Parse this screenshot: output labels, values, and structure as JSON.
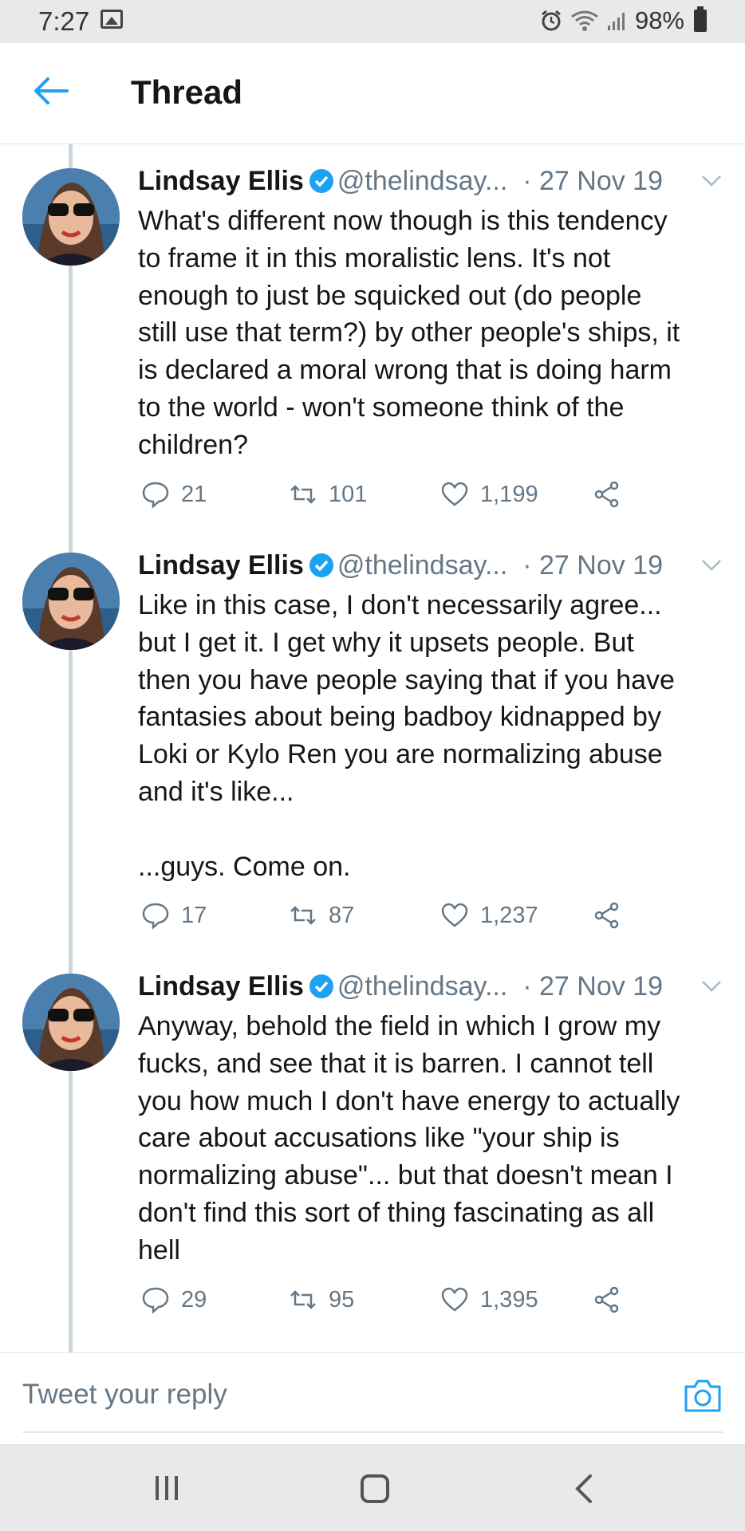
{
  "status_bar": {
    "time": "7:27",
    "battery": "98%"
  },
  "header": {
    "title": "Thread"
  },
  "tweets": [
    {
      "name": "Lindsay Ellis",
      "handle": "@thelindsay...",
      "date": "· 27 Nov 19",
      "text": "What's different now though is this tendency\nto frame it in this moralistic lens. It's not\nenough to just be squicked out (do people\nstill use that term?) by other people's ships, it\nis declared a moral wrong that is doing harm\nto the world - won't someone think of the\nchildren?",
      "replies": "21",
      "retweets": "101",
      "likes": "1,199"
    },
    {
      "name": "Lindsay Ellis",
      "handle": "@thelindsay...",
      "date": "· 27 Nov 19",
      "text": "Like in this case, I don't necessarily agree...\nbut I get it. I get why it upsets people. But\nthen you have people saying that if you have\nfantasies about being badboy kidnapped by\nLoki or Kylo Ren you are normalizing abuse\nand it's like...\n\n...guys. Come on.",
      "replies": "17",
      "retweets": "87",
      "likes": "1,237"
    },
    {
      "name": "Lindsay Ellis",
      "handle": "@thelindsay...",
      "date": "· 27 Nov 19",
      "text": "Anyway, behold the field in which I grow my\nfucks, and see that it is barren. I cannot tell\nyou how much I don't have energy to actually\ncare about accusations like \"your ship is\nnormalizing abuse\"... but that doesn't mean I\ndon't find this sort of thing fascinating as all\nhell",
      "replies": "29",
      "retweets": "95",
      "likes": "1,395"
    }
  ],
  "reply": {
    "placeholder": "Tweet your reply"
  },
  "icons": {
    "accent": "#1da1f2",
    "verified": "#1da1f2",
    "muted": "#657786"
  }
}
